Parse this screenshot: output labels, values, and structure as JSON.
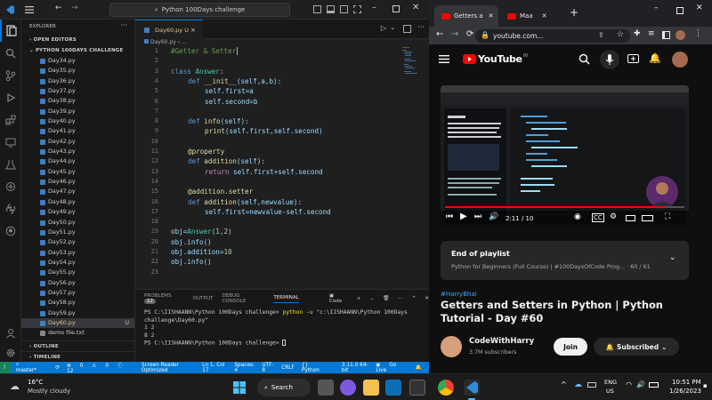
{
  "vscode": {
    "command_center": "Python 100Days challenge",
    "explorer_title": "EXPLORER",
    "open_editors": "OPEN EDITORS",
    "folder": "PYTHON 100DAYS CHALLENGE",
    "files": [
      "Day34.py",
      "Day35.py",
      "Day36.py",
      "Day37.py",
      "Day38.py",
      "Day39.py",
      "Day40.py",
      "Day41.py",
      "Day42.py",
      "Day43.py",
      "Day44.py",
      "Day45.py",
      "Day46.py",
      "Day47.py",
      "Day48.py",
      "Day49.py",
      "Day50.py",
      "Day51.py",
      "Day52.py",
      "Day53.py",
      "Day54.py",
      "Day55.py",
      "Day56.py",
      "Day57.py",
      "Day58.py",
      "Day59.py",
      "Day60.py"
    ],
    "other_file": "demo file.txt",
    "active_file_badge": "U",
    "outline": "OUTLINE",
    "timeline": "TIMELINE",
    "tab_label": "Day60.py",
    "tab_badge": "U",
    "breadcrumb": "Day60.py",
    "line_numbers": [
      "1",
      "2",
      "3",
      "4",
      "5",
      "6",
      "7",
      "8",
      "9",
      "10",
      "11",
      "12",
      "13",
      "14",
      "15",
      "16",
      "17",
      "18",
      "19",
      "20",
      "21",
      "22",
      "23"
    ],
    "code": {
      "l1": "#Getter & Setter",
      "l3_kw": "class",
      "l3_name": "Answer",
      "l4_kw": "def",
      "l4_fn": "__init__",
      "l4_args": "(self,a,b):",
      "l5": "self.first=a",
      "l6": "self.second=b",
      "l8_kw": "def",
      "l8_fn": "info",
      "l8_args": "(self):",
      "l9_fn": "print",
      "l9_args": "(self.first,self.second)",
      "l11": "@property",
      "l12_kw": "def",
      "l12_fn": "addition",
      "l12_args": "(self):",
      "l13_kw": "return",
      "l13_rest": "self.first+self.second",
      "l15": "@addition.setter",
      "l16_kw": "def",
      "l16_fn": "addition",
      "l16_args": "(self,newvalue):",
      "l17": "self.first=newvalue-self.second",
      "l19_a": "obj=",
      "l19_cls": "Answer",
      "l19_args": "(1,2)",
      "l20": "obj.info()",
      "l21_a": "obj.addition=",
      "l21_n": "10",
      "l22": "obj.info()"
    },
    "panel_tabs": {
      "problems": "PROBLEMS",
      "problems_count": "12",
      "output": "OUTPUT",
      "debug": "DEBUG CONSOLE",
      "terminal": "TERMINAL",
      "code_label": "Code"
    },
    "terminal": {
      "line1_prompt": "PS C:\\IISHAANN\\Python 100Days challenge>",
      "line1_cmd": "python",
      "line1_args": "-u \"c:\\IISHAANN\\Python 100Days",
      "line2": "challenge\\Day60.py\"",
      "line3": "1 2",
      "line4": "8 2",
      "line5": "PS C:\\IISHAANN\\Python 100Days challenge>"
    },
    "status": {
      "branch": "master*",
      "errors": "0",
      "warnings": "0",
      "info": "12",
      "screen_reader": "Screen Reader Optimized",
      "position": "Ln 1, Col 17",
      "spaces": "Spaces: 4",
      "encoding": "UTF-8",
      "eol": "CRLF",
      "language": "Python",
      "interpreter": "3.11.0 64-bit",
      "golive": "Go Live"
    }
  },
  "chrome": {
    "tab1": "Getters a",
    "tab2": "Maa",
    "url": "youtube.com...",
    "yt_logo": "YouTube",
    "yt_region": "IN",
    "player_time": "2:11 / 10",
    "playlist_title": "End of playlist",
    "playlist_sub": "Python for Beginners (Full Course) | #100DaysOfCode Prog... · 60 / 61",
    "hashtag": "#HarryBhai",
    "video_title": "Getters and Setters in Python | Python Tutorial - Day #60",
    "channel": "CodeWithHarry",
    "subscribers": "3.7M subscribers",
    "join": "Join",
    "subscribed": "Subscribed"
  },
  "taskbar": {
    "temp": "16°C",
    "weather": "Mostly cloudy",
    "search": "Search",
    "lang1": "ENG",
    "lang2": "US",
    "time": "10:51 PM",
    "date": "1/26/2023"
  },
  "colors": {
    "vscode_accent": "#0078d4",
    "youtube_red": "#ff0000",
    "modified": "#e2c08d"
  }
}
